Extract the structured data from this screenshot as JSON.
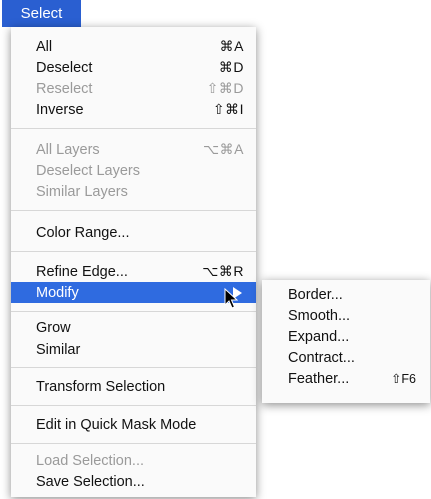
{
  "menubar": {
    "title": "Select"
  },
  "menu": {
    "items": [
      {
        "label": "All",
        "shortcut": "⌘A",
        "disabled": false
      },
      {
        "label": "Deselect",
        "shortcut": "⌘D",
        "disabled": false
      },
      {
        "label": "Reselect",
        "shortcut": "⇧⌘D",
        "disabled": true
      },
      {
        "label": "Inverse",
        "shortcut": "⇧⌘I",
        "disabled": false
      },
      {
        "label": "All Layers",
        "shortcut": "⌥⌘A",
        "disabled": true
      },
      {
        "label": "Deselect Layers",
        "shortcut": "",
        "disabled": true
      },
      {
        "label": "Similar Layers",
        "shortcut": "",
        "disabled": true
      },
      {
        "label": "Color Range...",
        "shortcut": "",
        "disabled": false
      },
      {
        "label": "Refine Edge...",
        "shortcut": "⌥⌘R",
        "disabled": false
      },
      {
        "label": "Modify",
        "shortcut": "",
        "disabled": false,
        "highlighted": true,
        "submenu_icon": "triangle-right-icon"
      },
      {
        "label": "Grow",
        "shortcut": "",
        "disabled": false
      },
      {
        "label": "Similar",
        "shortcut": "",
        "disabled": false
      },
      {
        "label": "Transform Selection",
        "shortcut": "",
        "disabled": false
      },
      {
        "label": "Edit in Quick Mask Mode",
        "shortcut": "",
        "disabled": false
      },
      {
        "label": "Load Selection...",
        "shortcut": "",
        "disabled": true
      },
      {
        "label": "Save Selection...",
        "shortcut": "",
        "disabled": false
      }
    ]
  },
  "submenu": {
    "items": [
      {
        "label": "Border...",
        "shortcut": ""
      },
      {
        "label": "Smooth...",
        "shortcut": ""
      },
      {
        "label": "Expand...",
        "shortcut": ""
      },
      {
        "label": "Contract...",
        "shortcut": ""
      },
      {
        "label": "Feather...",
        "shortcut": "⇧F6"
      }
    ]
  },
  "cursor": {
    "icon": "arrow-pointer-icon"
  },
  "colors": {
    "highlight": "#2f6be0",
    "menubar_title_bg": "#2a5fd1",
    "disabled_text": "#9a9a9a"
  }
}
